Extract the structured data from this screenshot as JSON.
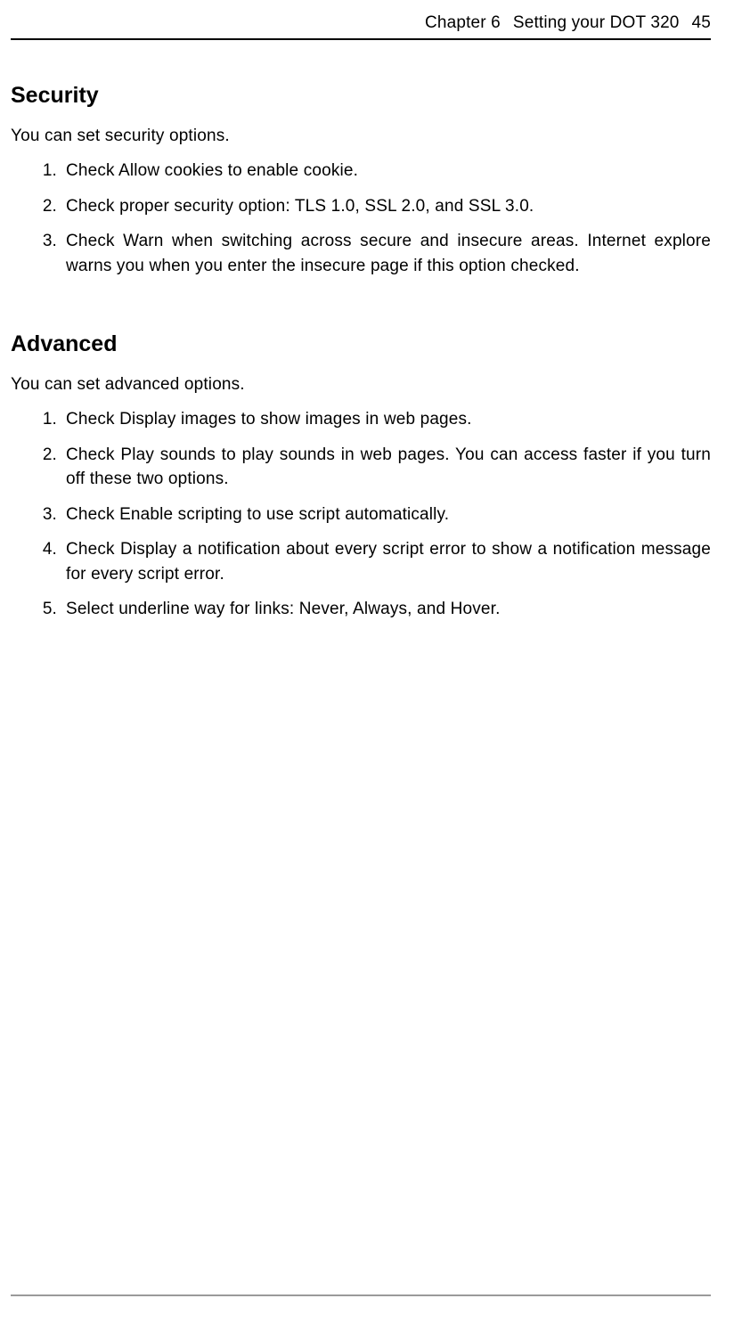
{
  "header": {
    "chapter_label": "Chapter 6",
    "chapter_title": "Setting your DOT 320",
    "page_number": "45"
  },
  "sections": [
    {
      "heading": "Security",
      "intro": "You can set security options.",
      "items": [
        {
          "num": "1.",
          "text": "Check Allow cookies to enable cookie."
        },
        {
          "num": "2.",
          "text": "Check proper security option: TLS 1.0, SSL 2.0, and SSL 3.0."
        },
        {
          "num": "3.",
          "text": "Check Warn when switching across secure and insecure areas. Internet explore warns you when you enter the insecure page if this option checked."
        }
      ]
    },
    {
      "heading": "Advanced",
      "intro": "You can set advanced options.",
      "items": [
        {
          "num": "1.",
          "text": "Check Display images to show images in web pages."
        },
        {
          "num": "2.",
          "text": "Check Play sounds to play sounds in web pages. You can access faster if you turn off these two options."
        },
        {
          "num": "3.",
          "text": "Check Enable scripting to use script automatically."
        },
        {
          "num": "4.",
          "text": "Check Display a notification about every script error to show a notification message for every script error."
        },
        {
          "num": "5.",
          "text": "Select underline way for links: Never, Always, and Hover."
        }
      ]
    }
  ]
}
